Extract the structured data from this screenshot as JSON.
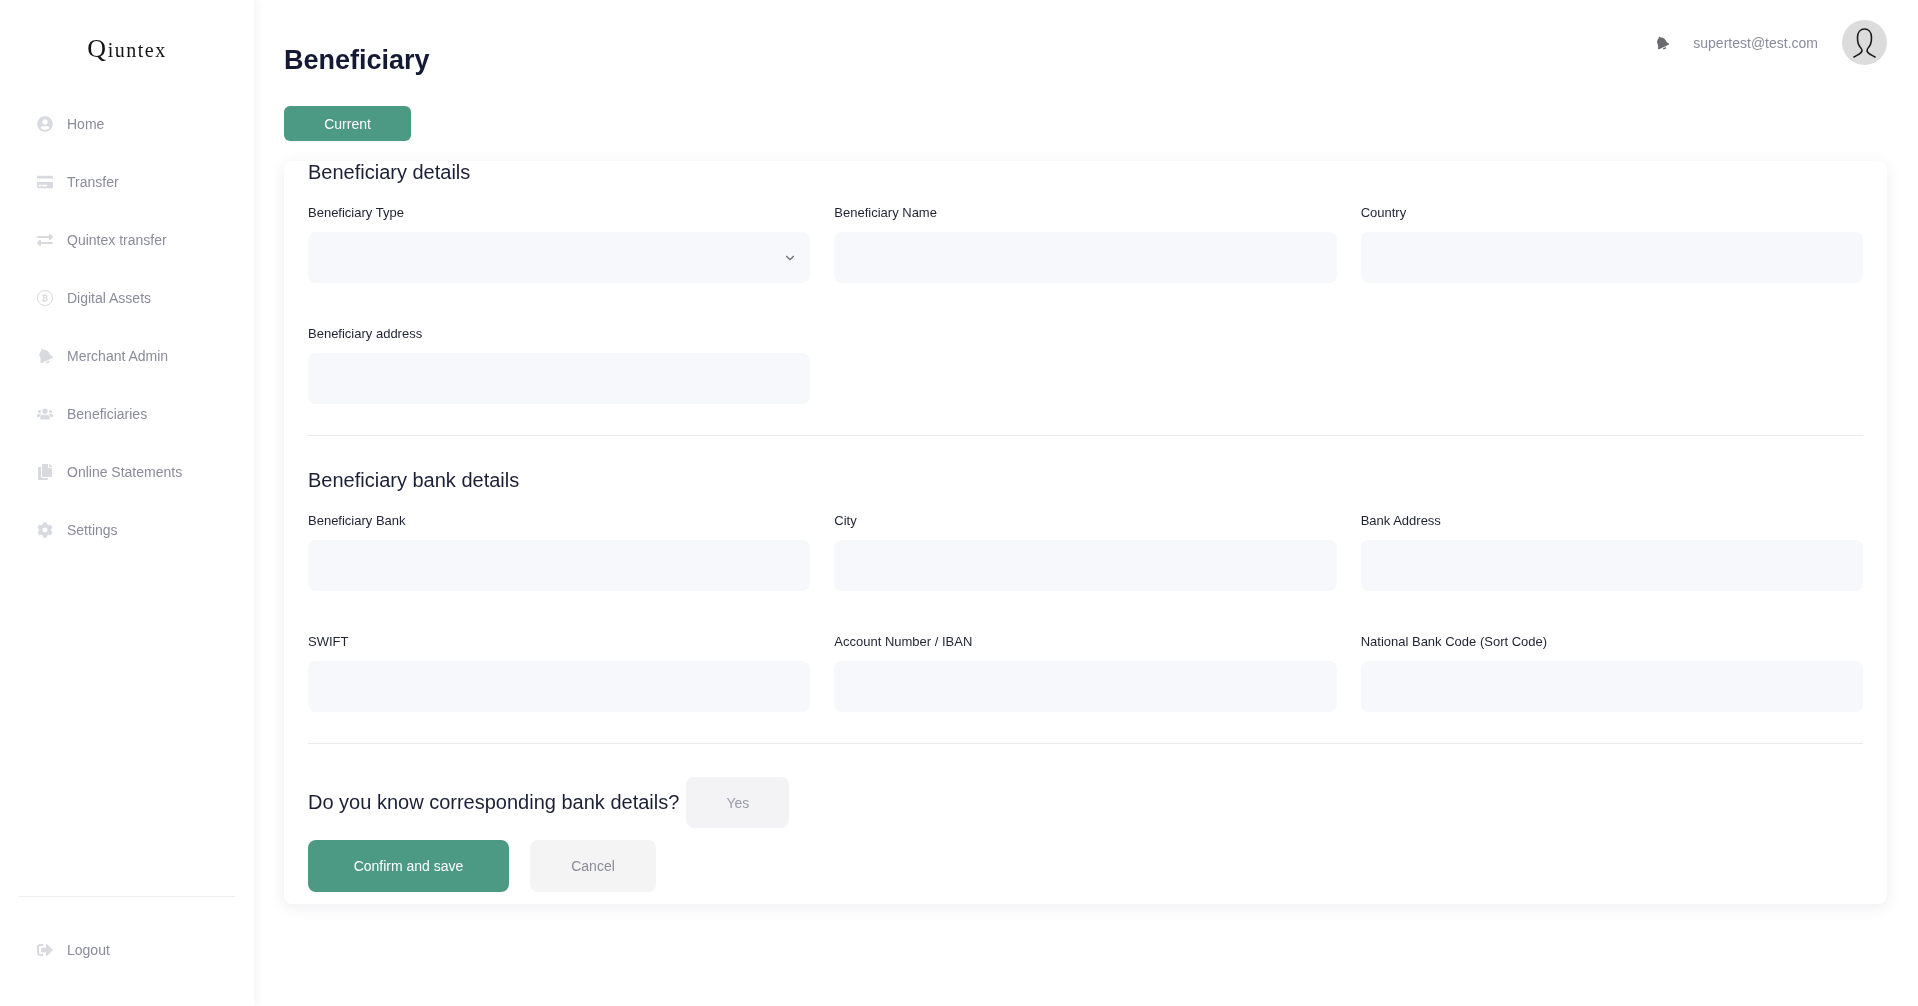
{
  "sidebar": {
    "logo": "Qiuntex",
    "items": [
      {
        "label": "Home",
        "selected": false
      },
      {
        "label": "Transfer",
        "selected": false
      },
      {
        "label": "Quintex transfer",
        "selected": false
      },
      {
        "label": "Digital Assets",
        "selected": false
      },
      {
        "label": "Merchant Admin",
        "selected": false
      },
      {
        "label": "Beneficiaries",
        "selected": false
      },
      {
        "label": "Online Statements",
        "selected": false
      },
      {
        "label": "Settings",
        "selected": false
      }
    ],
    "logout": "Logout"
  },
  "header": {
    "user_email": "supertest@test.com"
  },
  "page": {
    "title": "Beneficiary",
    "tabs": [
      {
        "label": "Current",
        "selected": true
      }
    ]
  },
  "form": {
    "sections": [
      {
        "title": "Beneficiary details",
        "fields": [
          {
            "label": "Beneficiary Type",
            "kind": "select"
          },
          {
            "label": "Beneficiary Name",
            "kind": "text"
          },
          {
            "label": "Country",
            "kind": "text"
          },
          {
            "label": "Beneficiary address",
            "kind": "text"
          }
        ]
      },
      {
        "title": "Beneficiary bank details",
        "fields": [
          {
            "label": "Beneficiary Bank",
            "kind": "text"
          },
          {
            "label": "City",
            "kind": "text"
          },
          {
            "label": "Bank Address",
            "kind": "text"
          },
          {
            "label": "SWIFT",
            "kind": "text"
          },
          {
            "label": "Account Number / IBAN",
            "kind": "text"
          },
          {
            "label": "National Bank Code (Sort Code)",
            "kind": "text"
          }
        ]
      }
    ],
    "question": {
      "text": "Do you know corresponding bank details?",
      "toggle": {
        "label": "Yes",
        "selected": false
      }
    },
    "actions": [
      {
        "label": "Confirm and save",
        "kind": "primary"
      },
      {
        "label": "Cancel",
        "kind": "secondary"
      }
    ]
  }
}
